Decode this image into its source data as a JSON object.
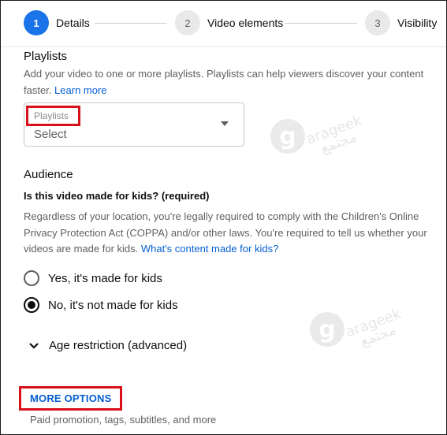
{
  "stepper": {
    "steps": [
      {
        "number": "1",
        "label": "Details"
      },
      {
        "number": "2",
        "label": "Video elements"
      },
      {
        "number": "3",
        "label": "Visibility"
      }
    ]
  },
  "playlists": {
    "heading": "Playlists",
    "description": "Add your video to one or more playlists. Playlists can help viewers discover your content faster.",
    "learn_more": "Learn more",
    "field_label": "Playlists",
    "field_value": "Select"
  },
  "audience": {
    "heading": "Audience",
    "question": "Is this video made for kids? (required)",
    "description": "Regardless of your location, you're legally required to comply with the Children's Online Privacy Protection Act (COPPA) and/or other laws. You're required to tell us whether your videos are made for kids.",
    "link": "What's content made for kids?",
    "options": [
      {
        "label": "Yes, it's made for kids",
        "selected": false
      },
      {
        "label": "No, it's not made for kids",
        "selected": true
      }
    ]
  },
  "age_restriction": {
    "label": "Age restriction (advanced)"
  },
  "more_options": {
    "button": "MORE OPTIONS",
    "subtitle": "Paid promotion, tags, subtitles, and more"
  },
  "watermark": {
    "letter": "g",
    "text": "arageek",
    "text_ar": "مجتمع"
  },
  "colors": {
    "accent": "#1a73e8",
    "link": "#065fd4",
    "highlight": "#d8101a"
  }
}
